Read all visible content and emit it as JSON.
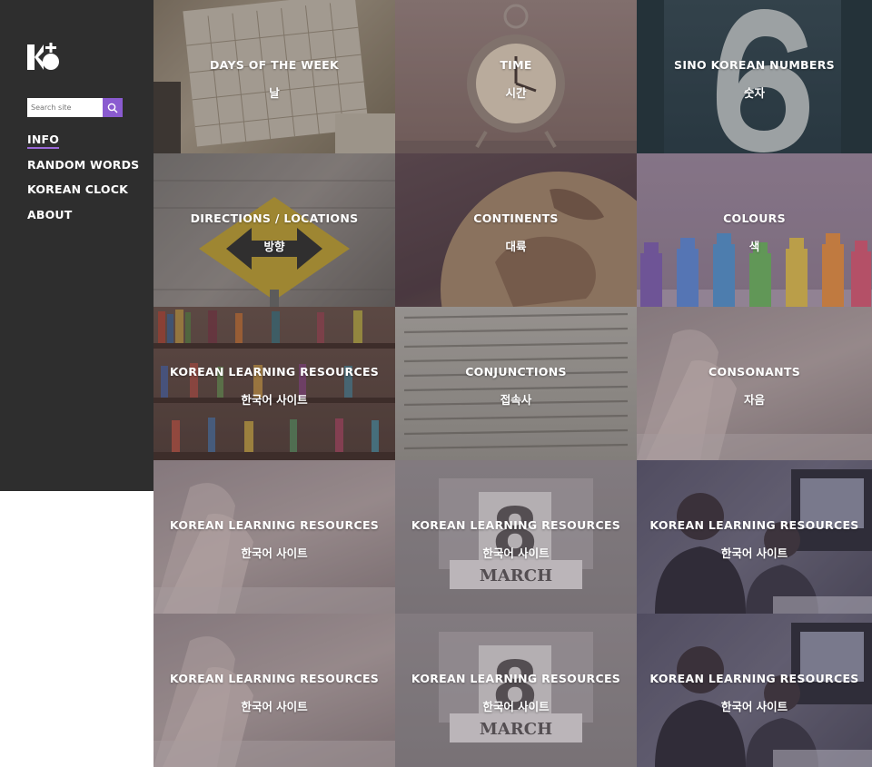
{
  "sidebar": {
    "search": {
      "placeholder": "Search site"
    },
    "nav": [
      {
        "label": "INFO",
        "active": true
      },
      {
        "label": "RANDOM WORDS",
        "active": false
      },
      {
        "label": "KOREAN CLOCK",
        "active": false
      },
      {
        "label": "ABOUT",
        "active": false
      }
    ]
  },
  "tiles": [
    {
      "title": "DAYS OF THE WEEK",
      "subtitle": "날"
    },
    {
      "title": "TIME",
      "subtitle": "시간"
    },
    {
      "title": "SINO KOREAN NUMBERS",
      "subtitle": "숫자"
    },
    {
      "title": "DIRECTIONS / LOCATIONS",
      "subtitle": "방향"
    },
    {
      "title": "CONTINENTS",
      "subtitle": "대륙"
    },
    {
      "title": "COLOURS",
      "subtitle": "색"
    },
    {
      "title": "KOREAN LEARNING RESOURCES",
      "subtitle": "한국어 사이트"
    },
    {
      "title": "CONJUNCTIONS",
      "subtitle": "접속사"
    },
    {
      "title": "CONSONANTS",
      "subtitle": "자음"
    },
    {
      "title": "KOREAN LEARNING RESOURCES",
      "subtitle": "한국어 사이트"
    },
    {
      "title": "KOREAN LEARNING RESOURCES",
      "subtitle": "한국어 사이트"
    },
    {
      "title": "KOREAN LEARNING RESOURCES",
      "subtitle": "한국어 사이트"
    },
    {
      "title": "KOREAN LEARNING RESOURCES",
      "subtitle": "한국어 사이트"
    },
    {
      "title": "KOREAN LEARNING RESOURCES",
      "subtitle": "한국어 사이트"
    },
    {
      "title": "KOREAN LEARNING RESOURCES",
      "subtitle": "한국어 사이트"
    }
  ],
  "colors": {
    "sidebar_bg": "#2e2e2e",
    "accent": "#8a5bd0",
    "text": "#ffffff"
  },
  "icons": {
    "logo": "ko-logo",
    "search": "search-icon"
  }
}
